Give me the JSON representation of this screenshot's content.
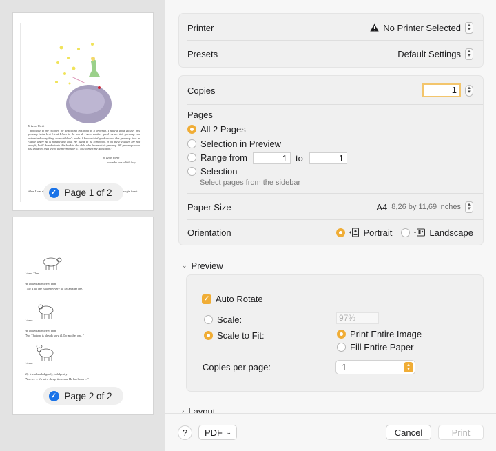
{
  "sidebar": {
    "page1_label": "Page 1 of 2",
    "page2_label": "Page 2 of 2",
    "page1_text": {
      "dedication": "To Leon Werth",
      "body": "I apologise to the children for dedicating this book to a grownup. I have a good excuse: this grownup is the best friend I have in the world. I have another good excuse: this grownup can understand everything, even children's books. I have a third good excuse: this grownup lives in France where he is hungry and cold. He needs to be comforted. If all these excuses are not enough, I will then dedicate this book to the child who became this grownup. All grownups were first children. (But few of them remember it.) So I correct my dedication:",
      "signoff1": "To Leon Werth",
      "signoff2": "when he was a little boy",
      "footer_left": "When I was si",
      "footer_right": "virgin forest"
    },
    "page2_text": {
      "l1": "I drew.  Then",
      "l2": "He looked attentively, then:",
      "l3": "\" No! That one is already very ill. Do another one.\"",
      "l4": "I drew:",
      "l5": "He looked attentively, then:",
      "l6": "\"No! That one is already very ill. Do another one. \"",
      "l7": "I drew:",
      "l8": "My friend smiled gently, indulgently:",
      "l9": "\"You see ... it's not a sheep, it's a ram. He has horns ... \""
    }
  },
  "printer": {
    "label": "Printer",
    "value": "No Printer Selected"
  },
  "presets": {
    "label": "Presets",
    "value": "Default Settings"
  },
  "copies": {
    "label": "Copies",
    "value": "1"
  },
  "pages": {
    "label": "Pages",
    "all": "All 2 Pages",
    "selection_preview": "Selection in Preview",
    "range_from": "Range from",
    "range_start": "1",
    "to": "to",
    "range_end": "1",
    "selection": "Selection",
    "selection_hint": "Select pages from the sidebar"
  },
  "paper_size": {
    "label": "Paper Size",
    "value": "A4",
    "dims": "8,26 by 11,69 inches"
  },
  "orientation": {
    "label": "Orientation",
    "portrait": "Portrait",
    "landscape": "Landscape"
  },
  "preview": {
    "section_label": "Preview",
    "auto_rotate": "Auto Rotate",
    "scale": "Scale:",
    "scale_value": "97%",
    "scale_to_fit": "Scale to Fit:",
    "print_entire": "Print Entire Image",
    "fill_entire": "Fill Entire Paper",
    "copies_per_page": "Copies per page:",
    "copies_per_page_value": "1"
  },
  "layout": {
    "section_label": "Layout"
  },
  "footer": {
    "help": "?",
    "pdf": "PDF",
    "cancel": "Cancel",
    "print": "Print"
  },
  "colors": {
    "accent": "#f0ad36",
    "selected_page": "#1a73e8"
  }
}
